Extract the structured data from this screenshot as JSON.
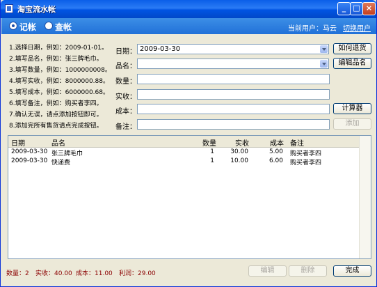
{
  "window": {
    "title": "淘宝流水帐"
  },
  "modes": {
    "record": "记帐",
    "query": "查帐"
  },
  "user": {
    "current_label": "当前用户：马云",
    "switch_label": "切换用户"
  },
  "steps": [
    "1.选择日期，例如：2009-01-01。",
    "2.填写品名，例如：张三牌毛巾。",
    "3.填写数量，例如：1000000008。",
    "4.填写实收，例如：8000000.88。",
    "5.填写成本，例如：6000000.68。",
    "6.填写备注，例如：购买者李四。",
    "7.确认无误，请点添加按钮即可。",
    "8.添加完所有售货请点完成按钮。"
  ],
  "form": {
    "date_label": "日期：",
    "date_value": "2009-03-30",
    "name_label": "品名：",
    "qty_label": "数量：",
    "received_label": "实收：",
    "cost_label": "成本：",
    "note_label": "备注："
  },
  "buttons": {
    "return": "如何退货",
    "edit_name": "编辑品名",
    "calculator": "计算器",
    "add": "添加",
    "edit": "编辑",
    "delete": "删除",
    "finish": "完成"
  },
  "table": {
    "headers": [
      "日期",
      "品名",
      "数量",
      "实收",
      "成本",
      "备注"
    ],
    "rows": [
      {
        "date": "2009-03-30",
        "name": "张三牌毛巾",
        "qty": "1",
        "received": "30.00",
        "cost": "5.00",
        "note": "购买者李四"
      },
      {
        "date": "2009-03-30",
        "name": "快递费",
        "qty": "1",
        "received": "10.00",
        "cost": "6.00",
        "note": "购买者李四"
      }
    ]
  },
  "summary": {
    "qty": "数量：2",
    "received": "实收：40.00",
    "cost": "成本：11.00",
    "profit": "利润：29.00"
  }
}
